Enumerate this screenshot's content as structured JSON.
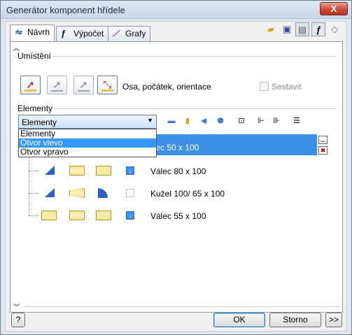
{
  "window": {
    "title": "Generátor komponent hřídele",
    "close_label": "X"
  },
  "tabs": [
    {
      "label": "Návrh",
      "icon": "shaft-design-icon"
    },
    {
      "label": "Výpočet",
      "icon": "fx-calculation-icon"
    },
    {
      "label": "Grafy",
      "icon": "graph-icon"
    }
  ],
  "toolbar": [
    "open-folder-icon",
    "save-icon",
    "results-icon",
    "fx-icon",
    "eraser-icon"
  ],
  "placement": {
    "label": "Umístění",
    "axis_text": "Osa, počátek, orientace",
    "assemble_label": "Sestavit",
    "assemble_checked": false
  },
  "elements": {
    "label": "Elementy",
    "combo_value": "Elementy",
    "dropdown_options": [
      "Elementy",
      "Otvor vlevo",
      "Otvor vpravo"
    ],
    "dropdown_selected": "Otvor vlevo",
    "rows": [
      {
        "text": "Válec 50 x 100",
        "selected": true
      },
      {
        "text": "Válec 80 x 100",
        "selected": false
      },
      {
        "text": "Kužel 100/ 65 x 100",
        "selected": false
      },
      {
        "text": "Válec 55 x 100",
        "selected": false
      }
    ],
    "more_label": "...",
    "delete_label": "✖"
  },
  "buttons": {
    "help": "?",
    "ok": "OK",
    "cancel": "Storno",
    "expand": ">>"
  }
}
